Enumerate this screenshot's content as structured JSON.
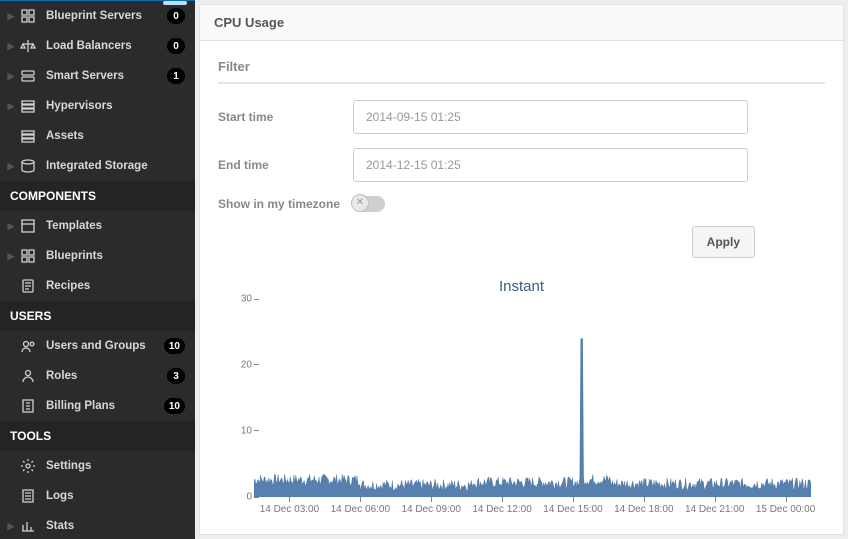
{
  "sidebar": {
    "groups": [
      {
        "items": [
          {
            "label": "Blueprint Servers",
            "icon": "grid",
            "chev": true,
            "badge": "0"
          },
          {
            "label": "Load Balancers",
            "icon": "balance",
            "chev": true,
            "badge": "0"
          },
          {
            "label": "Smart Servers",
            "icon": "server",
            "chev": true,
            "badge": "1"
          },
          {
            "label": "Hypervisors",
            "icon": "stack",
            "chev": true,
            "badge": null
          },
          {
            "label": "Assets",
            "icon": "stack",
            "chev": false,
            "badge": null
          },
          {
            "label": "Integrated Storage",
            "icon": "storage",
            "chev": true,
            "badge": null
          }
        ]
      },
      {
        "header": "COMPONENTS",
        "items": [
          {
            "label": "Templates",
            "icon": "template",
            "chev": true,
            "badge": null
          },
          {
            "label": "Blueprints",
            "icon": "grid",
            "chev": true,
            "badge": null
          },
          {
            "label": "Recipes",
            "icon": "recipe",
            "chev": false,
            "badge": null
          }
        ]
      },
      {
        "header": "USERS",
        "items": [
          {
            "label": "Users and Groups",
            "icon": "users",
            "chev": false,
            "badge": "10"
          },
          {
            "label": "Roles",
            "icon": "role",
            "chev": false,
            "badge": "3"
          },
          {
            "label": "Billing Plans",
            "icon": "bill",
            "chev": false,
            "badge": "10"
          }
        ]
      },
      {
        "header": "TOOLS",
        "items": [
          {
            "label": "Settings",
            "icon": "gear",
            "chev": false,
            "badge": null
          },
          {
            "label": "Logs",
            "icon": "logs",
            "chev": false,
            "badge": null
          },
          {
            "label": "Stats",
            "icon": "stats",
            "chev": true,
            "badge": null
          }
        ]
      }
    ]
  },
  "main": {
    "title": "CPU Usage",
    "filter": {
      "heading": "Filter",
      "start_label": "Start time",
      "start_value": "2014-09-15 01:25",
      "end_label": "End time",
      "end_value": "2014-12-15 01:25",
      "tz_label": "Show in my timezone",
      "tz_on": false,
      "apply_label": "Apply"
    }
  },
  "chart_data": {
    "type": "line",
    "title": "Instant",
    "xlabel": "",
    "ylabel": "",
    "ylim": [
      0,
      30
    ],
    "y_ticks": [
      0,
      10,
      20,
      30
    ],
    "x_ticks": [
      "14 Dec 03:00",
      "14 Dec 06:00",
      "14 Dec 09:00",
      "14 Dec 12:00",
      "14 Dec 15:00",
      "14 Dec 18:00",
      "14 Dec 21:00",
      "15 Dec 00:00"
    ],
    "series": [
      {
        "name": "cpu",
        "color": "#3b6aa0",
        "baseline": 2.3,
        "noise_amplitude": 0.9,
        "segments": [
          {
            "x0": 0.0,
            "x1": 0.19,
            "level": 2.6
          },
          {
            "x0": 0.19,
            "x1": 0.39,
            "level": 1.8
          },
          {
            "x0": 0.39,
            "x1": 0.585,
            "level": 2.2
          },
          {
            "x0": 0.585,
            "x1": 0.59,
            "level": 24.0,
            "noise": 0.0
          },
          {
            "x0": 0.59,
            "x1": 0.64,
            "level": 2.6
          },
          {
            "x0": 0.64,
            "x1": 1.0,
            "level": 2.0
          }
        ]
      }
    ]
  }
}
